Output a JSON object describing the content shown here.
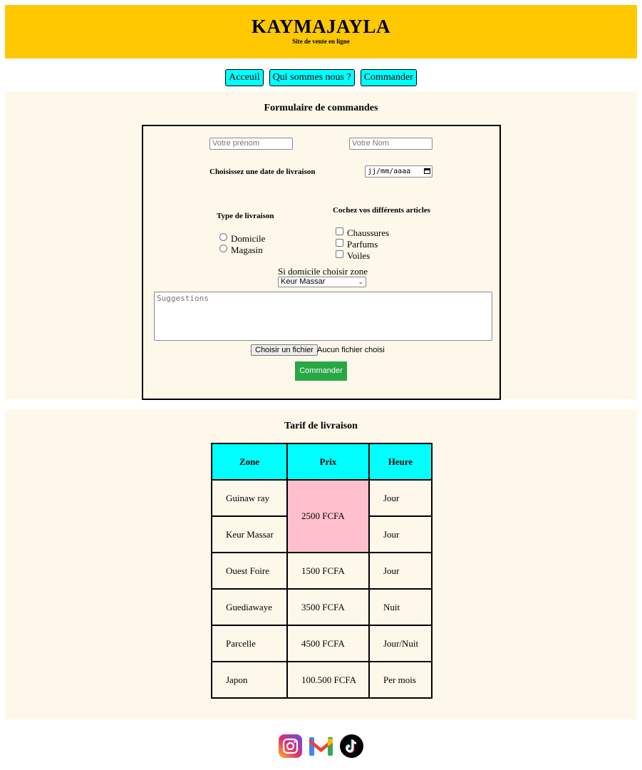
{
  "header": {
    "title": "KAYMAJAYLA",
    "subtitle": "Site de vente en ligne"
  },
  "nav": {
    "items": [
      "Acceuil",
      "Qui sommes nous ?",
      "Commander"
    ]
  },
  "order_form": {
    "title": "Formulaire de commandes",
    "firstname_placeholder": "Votre prénom",
    "lastname_placeholder": "Votre Nom",
    "date_label": "Choisissez une date de livraison",
    "date_value": "jj/mm/aaaa",
    "delivery_type_label": "Type de livraison",
    "delivery_options": [
      "Domicile",
      "Magasin"
    ],
    "articles_label": "Cochez vos différents articles",
    "articles": [
      "Chaussures",
      "Parfums",
      "Voiles"
    ],
    "zone_label": "Si domicile choisir zone",
    "zone_selected": "Keur Massar",
    "suggestions_placeholder": "Suggestions",
    "file_button": "Choisir un fichier",
    "file_status": "Aucun fichier choisi",
    "submit": "Commander"
  },
  "tarif": {
    "title": "Tarif de livraison",
    "headers": [
      "Zone",
      "Prix",
      "Heure"
    ],
    "rows": [
      {
        "zone": "Guinaw ray",
        "prix": "2500 FCFA",
        "heure": "Jour"
      },
      {
        "zone": "Keur Massar",
        "heure": "Jour"
      },
      {
        "zone": "Ouest Foire",
        "prix": "1500 FCFA",
        "heure": "Jour"
      },
      {
        "zone": "Guediawaye",
        "prix": "3500 FCFA",
        "heure": "Nuit"
      },
      {
        "zone": "Parcelle",
        "prix": "4500 FCFA",
        "heure": "Jour/Nuit"
      },
      {
        "zone": "Japon",
        "prix": "100.500 FCFA",
        "heure": "Per mois"
      }
    ]
  },
  "footer": {
    "icons": [
      "instagram-icon",
      "gmail-icon",
      "tiktok-icon"
    ]
  }
}
